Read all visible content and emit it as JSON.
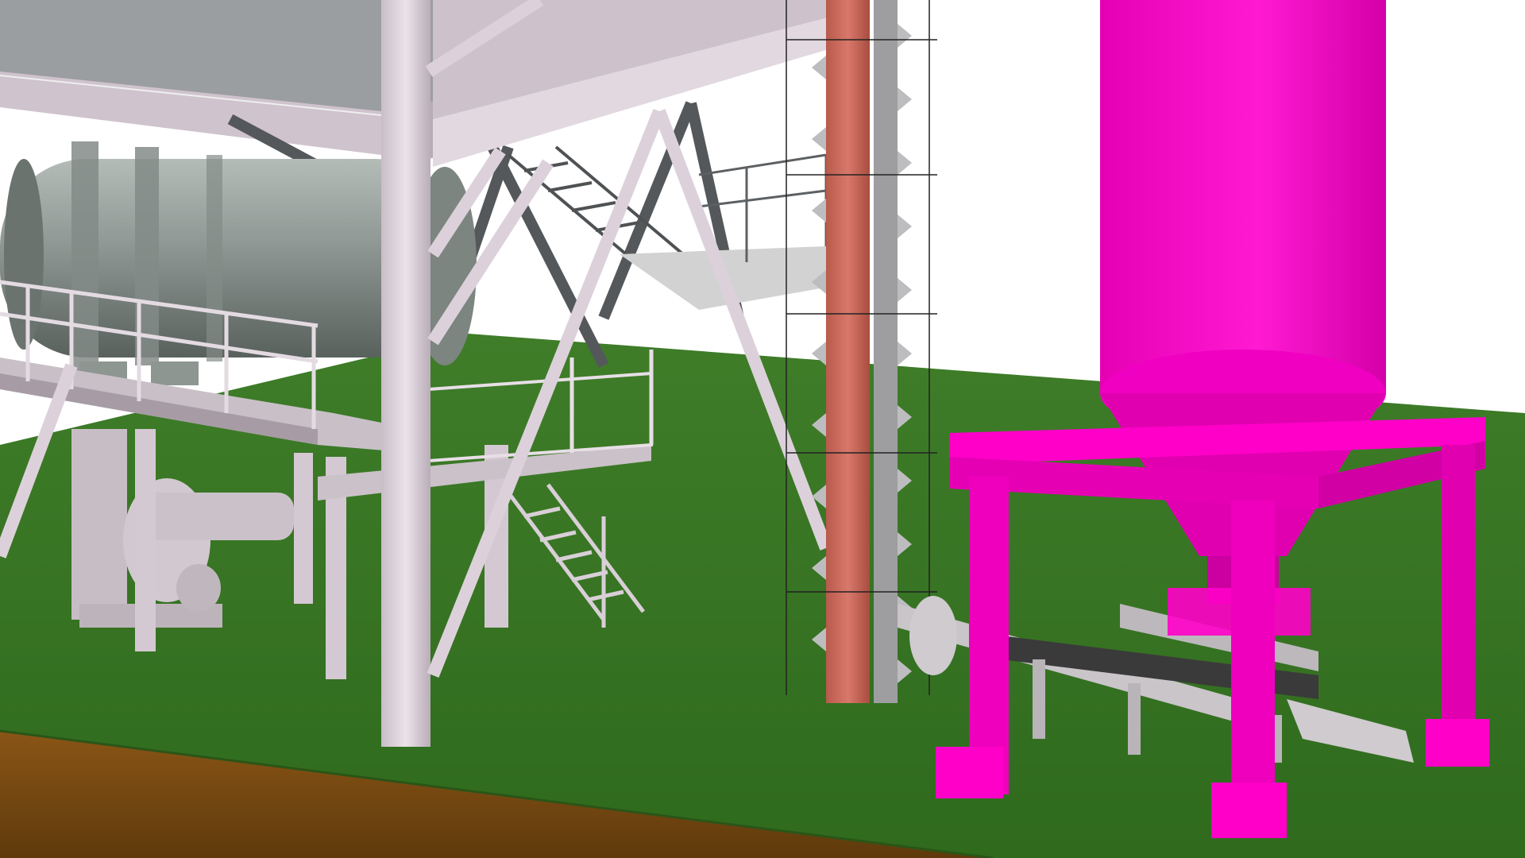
{
  "scene": {
    "description_tags": [
      "rotary-dryer",
      "steel-structure",
      "bucket-elevator",
      "silo",
      "belt-conveyor",
      "stairs",
      "platform-railings"
    ],
    "colors": {
      "sky": "#ffffff",
      "grass": "#3c7a26",
      "soil": "#7a4a14",
      "steel": "#d9cdd6",
      "steel_dark": "#5e6163",
      "dryer": "#8e9692",
      "elevator": "#c96a5a",
      "silo": "#ff00c8"
    }
  }
}
